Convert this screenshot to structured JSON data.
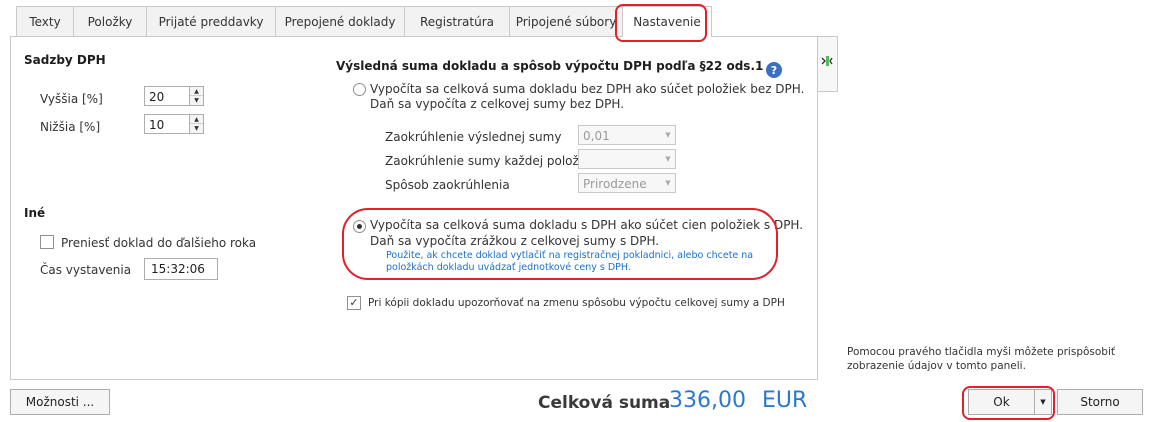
{
  "tabs": [
    {
      "label": "Texty"
    },
    {
      "label": "Položky"
    },
    {
      "label": "Prijaté preddavky"
    },
    {
      "label": "Prepojené doklady"
    },
    {
      "label": "Registratúra"
    },
    {
      "label": "Pripojené súbory"
    },
    {
      "label": "Nastavenie",
      "active": true
    }
  ],
  "vat": {
    "title": "Sadzby DPH",
    "higher_label": "Vyššia [%]",
    "higher_value": "20",
    "lower_label": "Nižšia [%]",
    "lower_value": "10"
  },
  "other": {
    "title": "Iné",
    "transfer_label": "Preniesť doklad do ďalšieho roka",
    "time_label": "Čas vystavenia",
    "time_value": "15:32:06"
  },
  "calc": {
    "title": "Výsledná suma dokladu a spôsob výpočtu DPH podľa §22 ods.1",
    "option1_line1": "Vypočíta sa celková suma dokladu bez DPH ako súčet položiek bez DPH.",
    "option1_line2": "Daň sa vypočíta z celkovej sumy bez DPH.",
    "round_total_label": "Zaokrúhlenie výslednej sumy",
    "round_total_value": "0,01",
    "round_item_label": "Zaokrúhlenie sumy každej položky",
    "round_item_value": "",
    "round_method_label": "Spôsob zaokrúhlenia",
    "round_method_value": "Prirodzene",
    "option2_line1": "Vypočíta sa celková suma dokladu s DPH ako súčet cien položiek s DPH.",
    "option2_line2": "Daň sa vypočíta zrážkou z celkovej sumy s DPH.",
    "hint_line1": "Použite, ak chcete doklad vytlačiť na registračnej pokladnici, alebo chcete na",
    "hint_line2": "položkách dokladu uvádzať jednotkové ceny s DPH.",
    "copy_warn_label": "Pri kópii dokladu upozorňovať na zmenu spôsobu výpočtu celkovej sumy a DPH"
  },
  "footer": {
    "options_label": "Možnosti ...",
    "total_label": "Celková suma",
    "total_value": "336,00",
    "currency": "EUR",
    "ok_label": "Ok",
    "cancel_label": "Storno",
    "hint_line1": "Pomocou pravého tlačidla myši môžete prispôsobiť",
    "hint_line2": "zobrazenie údajov v tomto paneli."
  },
  "colors": {
    "accent_blue": "#2b78d0",
    "highlight_red": "#e0202a",
    "hint_blue": "#1a6fd0"
  },
  "icons": {
    "help": "question-mark",
    "side_toggle": "panel-toggle"
  }
}
